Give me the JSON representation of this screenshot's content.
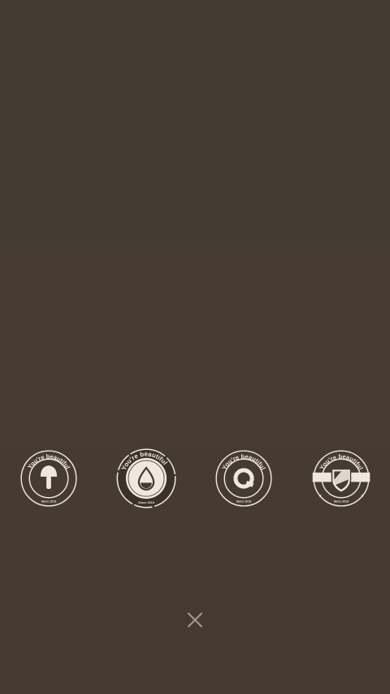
{
  "badges": [
    {
      "id": "mushroom",
      "icon": "mushroom-icon",
      "top_text": "You're beautiful",
      "bottom_text": "Since 2015",
      "selected": false
    },
    {
      "id": "drop",
      "icon": "water-drop-icon",
      "top_text": "You're beautiful",
      "bottom_text": "Since 2015",
      "selected": true
    },
    {
      "id": "q",
      "icon": "q-letter-icon",
      "top_text": "You're beautiful",
      "bottom_text": "Since 2015",
      "selected": false
    },
    {
      "id": "shield",
      "icon": "shield-icon",
      "top_text": "You're beautiful",
      "bottom_text": "Since 2015",
      "selected": false
    }
  ],
  "close_icon": "close-icon",
  "colors": {
    "background": "#443b31",
    "badge_fg": "#efe8dc"
  }
}
